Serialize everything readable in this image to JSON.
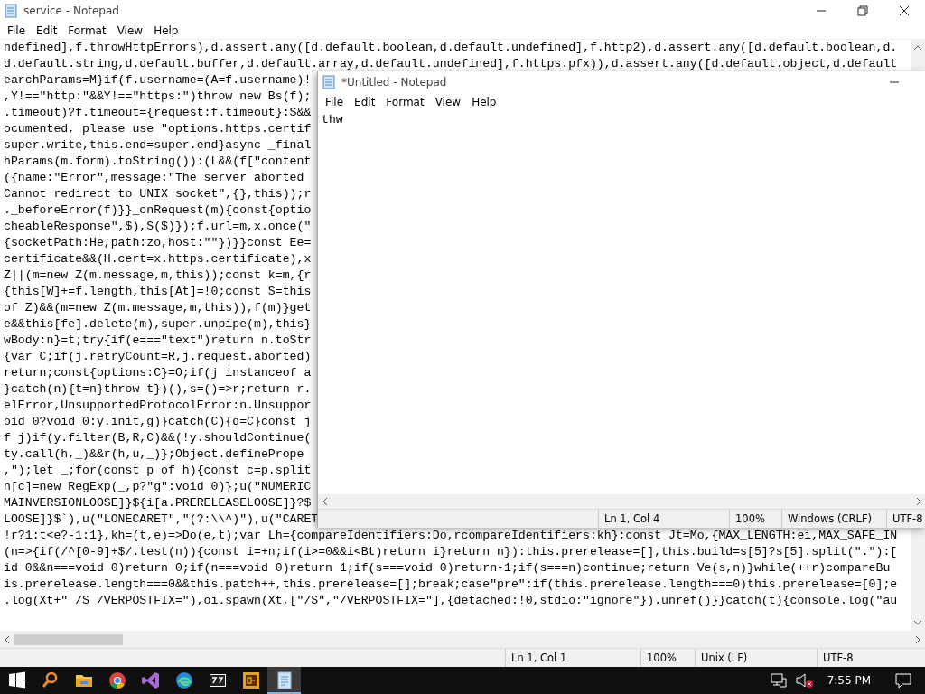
{
  "main_window": {
    "title": "service - Notepad",
    "menu": [
      "File",
      "Edit",
      "Format",
      "View",
      "Help"
    ],
    "lines": [
      "ndefined],f.throwHttpErrors),d.assert.any([d.default.boolean,d.default.undefined],f.http2),d.assert.any([d.default.boolean,d.",
      "d.default.string,d.default.buffer,d.default.array,d.default.undefined],f.https.pfx)),d.assert.any([d.default.object,d.default",
      "earchParams=M}if(f.username=(A=f.username)!",
      ",Y!==\"http:\"&&Y!==\"https:\")throw new Bs(f);",
      ".timeout)?f.timeout={request:f.timeout}:S&&",
      "ocumented, please use \"options.https.certif",
      "super.write,this.end=super.end}async _final",
      "hParams(m.form).toString()):(L&&(f[\"content",
      "({name:\"Error\",message:\"The server aborted",
      "Cannot redirect to UNIX socket\",{},this));r",
      "._beforeError(f)}}_onRequest(m){const{optio",
      "cheableResponse\",$),S($)});f.url=m,x.once(\"",
      "{socketPath:He,path:zo,host:\"\"})}}const Ee=",
      "certificate&&(H.cert=x.https.certificate),x",
      "Z||(m=new Z(m.message,m,this));const k=m,{r",
      "{this[W]+=f.length,this[At]=!0;const S=this",
      "of Z)&&(m=new Z(m.message,m,this)),f(m)}get",
      "e&&this[fe].delete(m),super.unpipe(m),this}",
      "wBody:n}=t;try{if(e===\"text\")return n.toStr",
      "{var C;if(j.retryCount=R,j.request.aborted)",
      "return;const{options:C}=O;if(j instanceof a",
      "}catch(n){t=n}throw t})(),s=()=>r;return r.",
      "elError,UnsupportedProtocolError:n.Unsuppor",
      "oid 0?void 0:y.init,g)}catch(C){q=C}const j",
      "f j)if(y.filter(B,R,C)&&(!y.shouldContinue(",
      "ty.call(h,_)&&r(h,u,_)};Object.definePrope",
      ",\");let _;for(const p of h){const c=p.split",
      "n[c]=new RegExp(_,p?\"g\":void 0)};u(\"NUMERIC",
      "MAINVERSIONLOOSE]}${i[a.PRERELEASELOOSE]}?$",
      "LOOSE]}$`),u(\"LONECARET\",\"(?:\\\\^)\"),u(\"CARET",
      "!r?1:t<e?-1:1},kh=(t,e)=>Do(e,t);var Lh={compareIdentifiers:Do,rcompareIdentifiers:kh};const Jt=Mo,{MAX_LENGTH:ei,MAX_SAFE_IN",
      "(n=>{if(/^[0-9]+$/.test(n)){const i=+n;if(i>=0&&i<Bt)return i}return n}):this.prerelease=[],this.build=s[5]?s[5].split(\".\"):[",
      "id 0&&n===void 0)return 0;if(n===void 0)return 1;if(s===void 0)return-1;if(s===n)continue;return Ve(s,n)}while(++r)compareBu",
      "is.prerelease.length===0&&this.patch++,this.prerelease=[];break;case\"pre\":if(this.prerelease.length===0)this.prerelease=[0];e",
      ".log(Xt+\" /S /VERPOSTFIX=\"),oi.spawn(Xt,[\"/S\",\"/VERPOSTFIX=\"],{detached:!0,stdio:\"ignore\"}).unref()}}catch(t){console.log(\"au"
    ],
    "status_bar": {
      "position": "Ln 1, Col 1",
      "zoom": "100%",
      "line_ending": "Unix (LF)",
      "encoding": "UTF-8"
    }
  },
  "overlay_window": {
    "title": "*Untitled - Notepad",
    "menu": [
      "File",
      "Edit",
      "Format",
      "View",
      "Help"
    ],
    "text": "thw",
    "status_bar": {
      "position": "Ln 1, Col 4",
      "zoom": "100%",
      "line_ending": "Windows (CRLF)",
      "encoding": "UTF-8"
    }
  },
  "taskbar": {
    "apps": [
      {
        "kind": "start",
        "selected": false
      },
      {
        "kind": "search",
        "selected": false
      },
      {
        "kind": "folder",
        "selected": false
      },
      {
        "kind": "chrome",
        "selected": false
      },
      {
        "kind": "studio",
        "selected": false
      },
      {
        "kind": "edge",
        "selected": false
      },
      {
        "kind": "archive",
        "selected": false
      },
      {
        "kind": "app",
        "selected": false
      },
      {
        "kind": "notepad",
        "selected": true
      }
    ],
    "clock": "7:55 PM"
  }
}
